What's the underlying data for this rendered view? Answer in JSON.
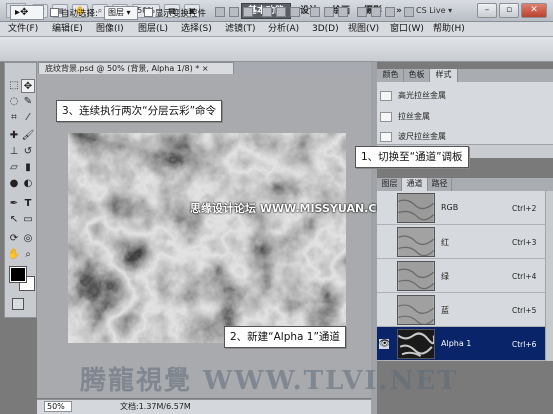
{
  "title_bar": {
    "app_logo": "Ps",
    "zoom": "50%",
    "workspaces": [
      "基本功能",
      "设计",
      "绘画",
      "摄影"
    ],
    "more": "»",
    "cs_live": "CS Live ▾"
  },
  "menu": [
    "文件(F)",
    "编辑(E)",
    "图像(I)",
    "图层(L)",
    "选择(S)",
    "滤镜(T)",
    "分析(A)",
    "3D(D)",
    "视图(V)",
    "窗口(W)",
    "帮助(H)"
  ],
  "options": {
    "auto_select_label": "自动选择:",
    "auto_select_value": "图层",
    "show_transform_label": "显示变换控件"
  },
  "document": {
    "tab_title": "底纹背景.psd @ 50% (背景, Alpha 1/8) * ×",
    "zoom_field": "50%",
    "doc_info": "文档:1.37M/6.57M"
  },
  "styles_panel": {
    "tabs": [
      "颜色",
      "色板",
      "样式"
    ],
    "active_tab": "样式",
    "items": [
      "高光拉丝金属",
      "拉丝金属",
      "波尺拉丝金属"
    ]
  },
  "channels_panel": {
    "tabs": [
      "图层",
      "通道",
      "路径"
    ],
    "active_tab": "通道",
    "channels": [
      {
        "name": "RGB",
        "shortcut": "Ctrl+2",
        "selected": false
      },
      {
        "name": "红",
        "shortcut": "Ctrl+3",
        "selected": false
      },
      {
        "name": "绿",
        "shortcut": "Ctrl+4",
        "selected": false
      },
      {
        "name": "蓝",
        "shortcut": "Ctrl+5",
        "selected": false
      },
      {
        "name": "Alpha 1",
        "shortcut": "Ctrl+6",
        "selected": true
      }
    ]
  },
  "callouts": {
    "step1": "1、切换至“通道”调板",
    "step2": "2、新建“Alpha 1”通道",
    "step3": "3、连续执行两次“分层云彩”命令"
  },
  "watermarks": {
    "main": "腾龍視覺 WWW.TLVI.NET",
    "site": "思缘设计论坛 WWW.MISSYUAN.COM"
  },
  "colors": {
    "selected_row": "#0a246a",
    "foreground": "#000000",
    "background": "#ffffff"
  }
}
